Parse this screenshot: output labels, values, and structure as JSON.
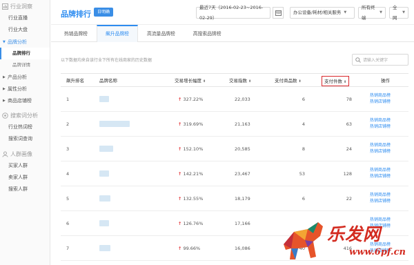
{
  "sidebar": {
    "group1": "行业洞察",
    "group1_items": [
      "行业直播",
      "行业大盘"
    ],
    "brand_analysis": "品牌分析",
    "brand_subs": [
      "品牌排行",
      "品牌详情"
    ],
    "parents": [
      "产品分析",
      "属性分析",
      "商品店铺榜"
    ],
    "group2": "搜索词分析",
    "group2_items": [
      "行业热词榜",
      "搜索词查询"
    ],
    "group3": "人群画像",
    "group3_items": [
      "买家人群",
      "卖家人群",
      "搜索人群"
    ]
  },
  "header": {
    "title": "品牌排行",
    "badge": "日明确",
    "date_range": "最近7天（2016-02-23~2016-02-29）",
    "category": "办公设备/耗材/相关服务",
    "terminal": "所有终端",
    "region": "全网"
  },
  "tabs": [
    "热销品牌榜",
    "飙升品牌榜",
    "高流量品牌榜",
    "高搜索品牌榜"
  ],
  "active_tab_index": 1,
  "note": "以下数据均来自该行业下所有在线商家的历史数据",
  "search": {
    "placeholder": "请输入关键字"
  },
  "table": {
    "columns": {
      "rank": "飙升排名",
      "brand": "品牌名称",
      "growth": "交易增长幅度",
      "index": "交易指数",
      "pay_items": "支付商品数",
      "pay_count": "支付件数",
      "action": "操作"
    },
    "rows": [
      {
        "rank": "1",
        "growth": "327.22%",
        "index": "22,033",
        "pay_items": "6",
        "pay_count": "78"
      },
      {
        "rank": "2",
        "growth": "319.69%",
        "index": "21,163",
        "pay_items": "4",
        "pay_count": "63"
      },
      {
        "rank": "3",
        "growth": "152.10%",
        "index": "20,585",
        "pay_items": "8",
        "pay_count": "24"
      },
      {
        "rank": "4",
        "growth": "142.21%",
        "index": "23,467",
        "pay_items": "53",
        "pay_count": "128"
      },
      {
        "rank": "5",
        "growth": "132.55%",
        "index": "18,179",
        "pay_items": "6",
        "pay_count": "22"
      },
      {
        "rank": "6",
        "growth": "126.76%",
        "index": "17,166",
        "pay_items": "",
        "pay_count": ""
      },
      {
        "rank": "7",
        "growth": "99.66%",
        "index": "16,086",
        "pay_items": "40",
        "pay_count": "416"
      }
    ],
    "op_hot_items": "热销商品榜",
    "op_hot_shops": "热销店铺榜"
  },
  "watermark": {
    "text": "乐发网",
    "url": "www.6pf.cn"
  }
}
